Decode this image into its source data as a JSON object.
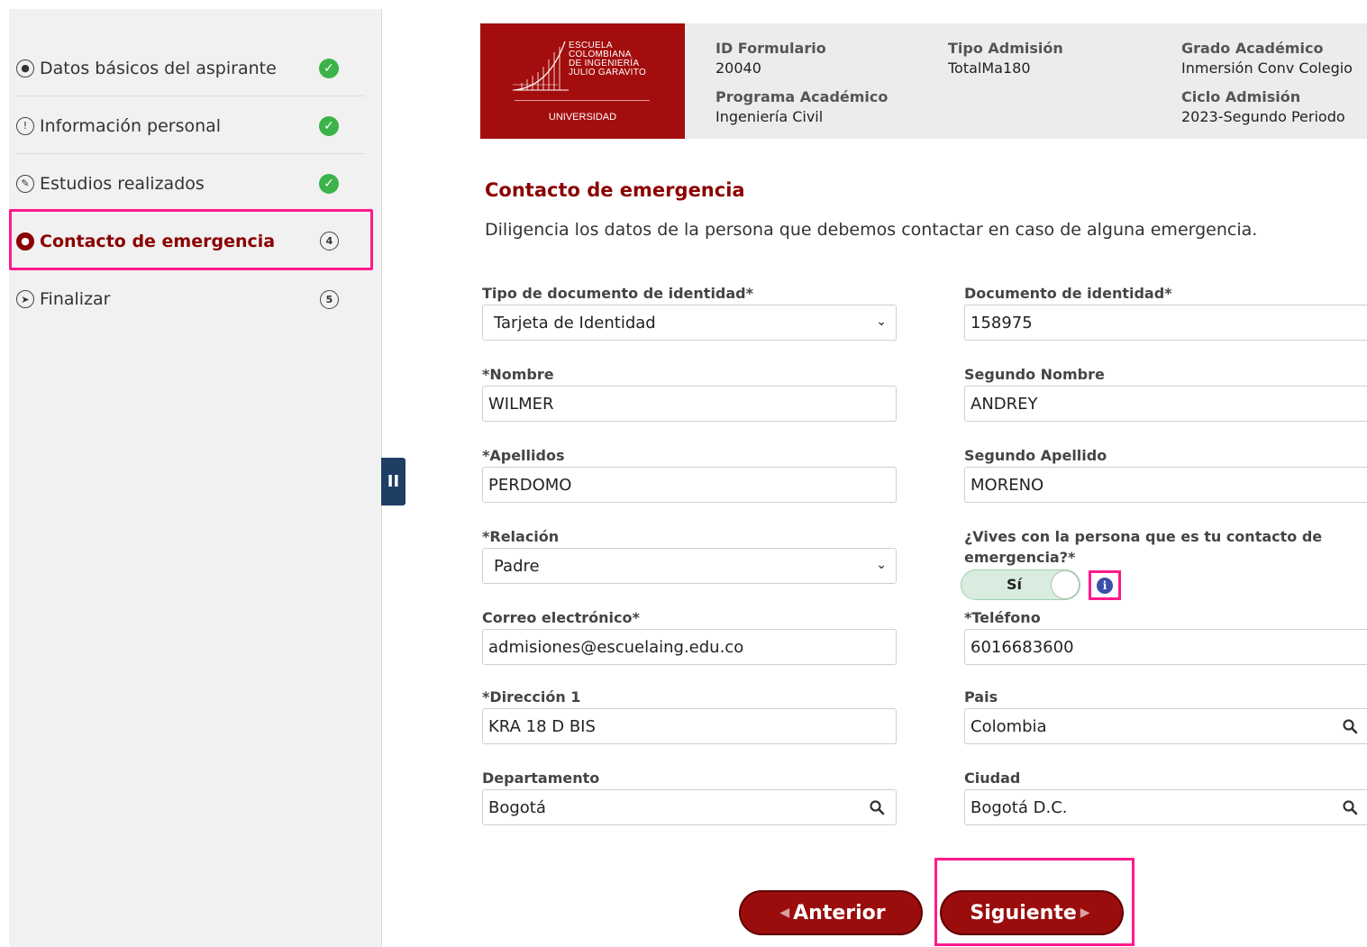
{
  "sidebar": {
    "steps": [
      {
        "label": "Datos básicos del aspirante",
        "status": "done"
      },
      {
        "label": "Información personal",
        "status": "done"
      },
      {
        "label": "Estudios realizados",
        "status": "done"
      },
      {
        "label": "Contacto de emergencia",
        "status": "4"
      },
      {
        "label": "Finalizar",
        "status": "5"
      }
    ]
  },
  "header": {
    "logo": {
      "line1": "ESCUELA",
      "line2": "COLOMBIANA",
      "line3": "DE INGENIERÍA",
      "line4": "JULIO GARAVITO",
      "sub": "UNIVERSIDAD"
    },
    "id_formulario_label": "ID Formulario",
    "id_formulario": "20040",
    "tipo_admision_label": "Tipo Admisión",
    "tipo_admision": "TotalMa180",
    "grado_label": "Grado Académico",
    "grado": "Inmersión Conv Colegio",
    "programa_label": "Programa Académico",
    "programa": "Ingeniería Civil",
    "ciclo_label": "Ciclo Admisión",
    "ciclo": "2023-Segundo Periodo"
  },
  "form": {
    "title": "Contacto de emergencia",
    "description": "Diligencia los datos de la persona que debemos contactar en caso de alguna emergencia.",
    "tipo_doc_label": "Tipo de documento de identidad*",
    "tipo_doc": "Tarjeta de Identidad",
    "documento_label": "Documento de identidad*",
    "documento": "158975",
    "nombre_label": "*Nombre",
    "nombre": "WILMER",
    "segundo_nombre_label": "Segundo Nombre",
    "segundo_nombre": "ANDREY",
    "apellidos_label": "*Apellidos",
    "apellidos": "PERDOMO",
    "segundo_apellido_label": "Segundo Apellido",
    "segundo_apellido": "MORENO",
    "relacion_label": "*Relación",
    "relacion": "Padre",
    "vives_label": "¿Vives con la persona que es tu contacto de emergencia?*",
    "vives_value": "Sí",
    "correo_label": "Correo electrónico*",
    "correo": "admisiones@escuelaing.edu.co",
    "telefono_label": "*Teléfono",
    "telefono": "6016683600",
    "direccion_label": "*Dirección 1",
    "direccion": "KRA 18 D BIS",
    "pais_label": "Pais",
    "pais": "Colombia",
    "departamento_label": "Departamento",
    "departamento": "Bogotá",
    "ciudad_label": "Ciudad",
    "ciudad": "Bogotá D.C."
  },
  "buttons": {
    "prev": "Anterior",
    "next": "Siguiente"
  },
  "colors": {
    "brand": "#8b0000",
    "highlight": "#ff1a8c",
    "success": "#3cb34a"
  }
}
